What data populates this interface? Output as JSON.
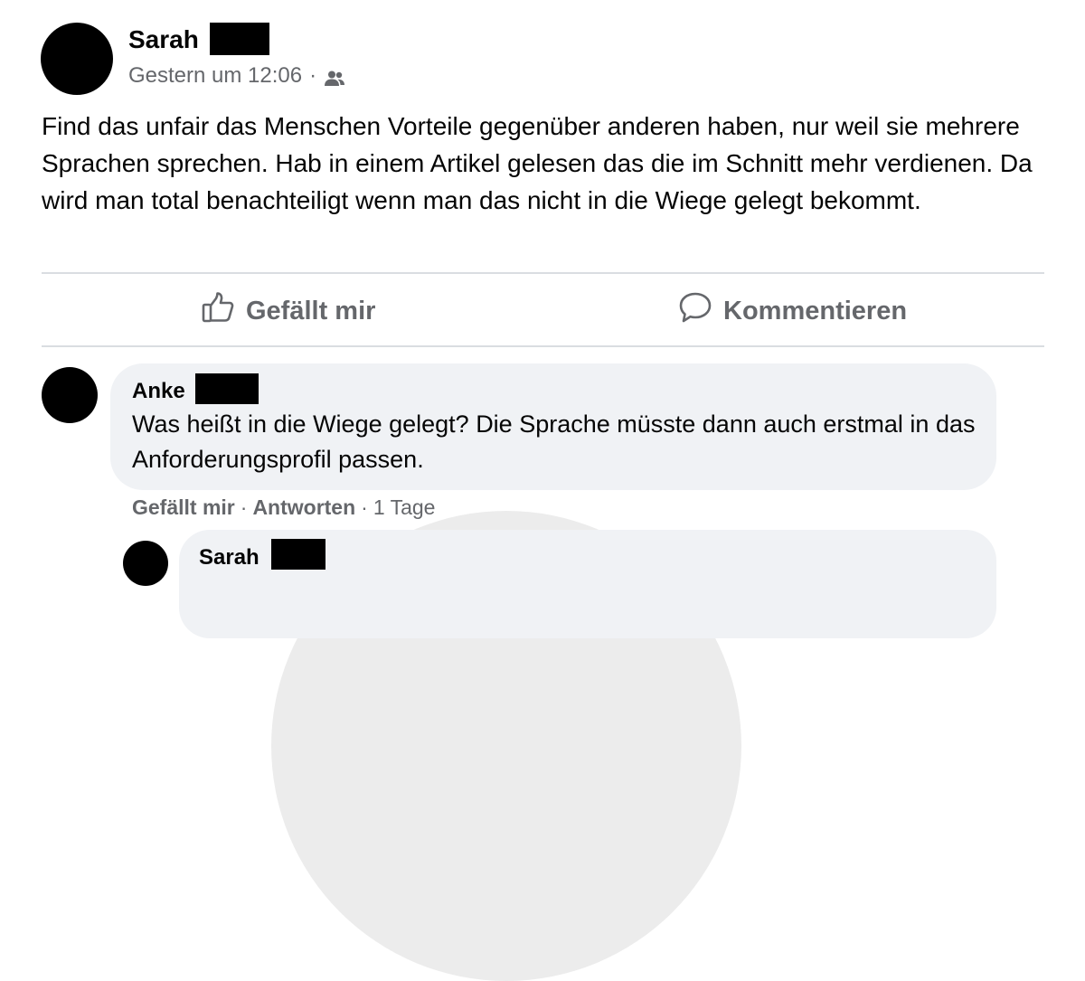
{
  "post": {
    "author": "Sarah",
    "timestamp": "Gestern um 12:06",
    "separator": "·",
    "audience_icon": "friends-icon",
    "text": "Find das unfair das Menschen Vorteile gegenüber anderen haben, nur weil sie mehrere Sprachen sprechen. Hab in einem Artikel gelesen das die im Schnitt mehr verdienen. Da wird man total benachteiligt wenn man das nicht in die Wiege gelegt bekommt."
  },
  "actions": {
    "like_label": "Gefällt mir",
    "like_icon": "thumbs-up-icon",
    "comment_label": "Kommentieren",
    "comment_icon": "speech-bubble-icon"
  },
  "comments": [
    {
      "author": "Anke",
      "text": "Was heißt in die Wiege gelegt? Die Sprache müsste dann auch erstmal in das Anforderungsprofil passen.",
      "like_label": "Gefällt mir",
      "reply_label": "Antworten",
      "separator": "·",
      "age": "1 Tage"
    },
    {
      "author": "Sarah"
    }
  ],
  "colors": {
    "secondary_text": "#65676b",
    "bubble_bg": "#f0f2f5",
    "divider": "#dadde1"
  }
}
